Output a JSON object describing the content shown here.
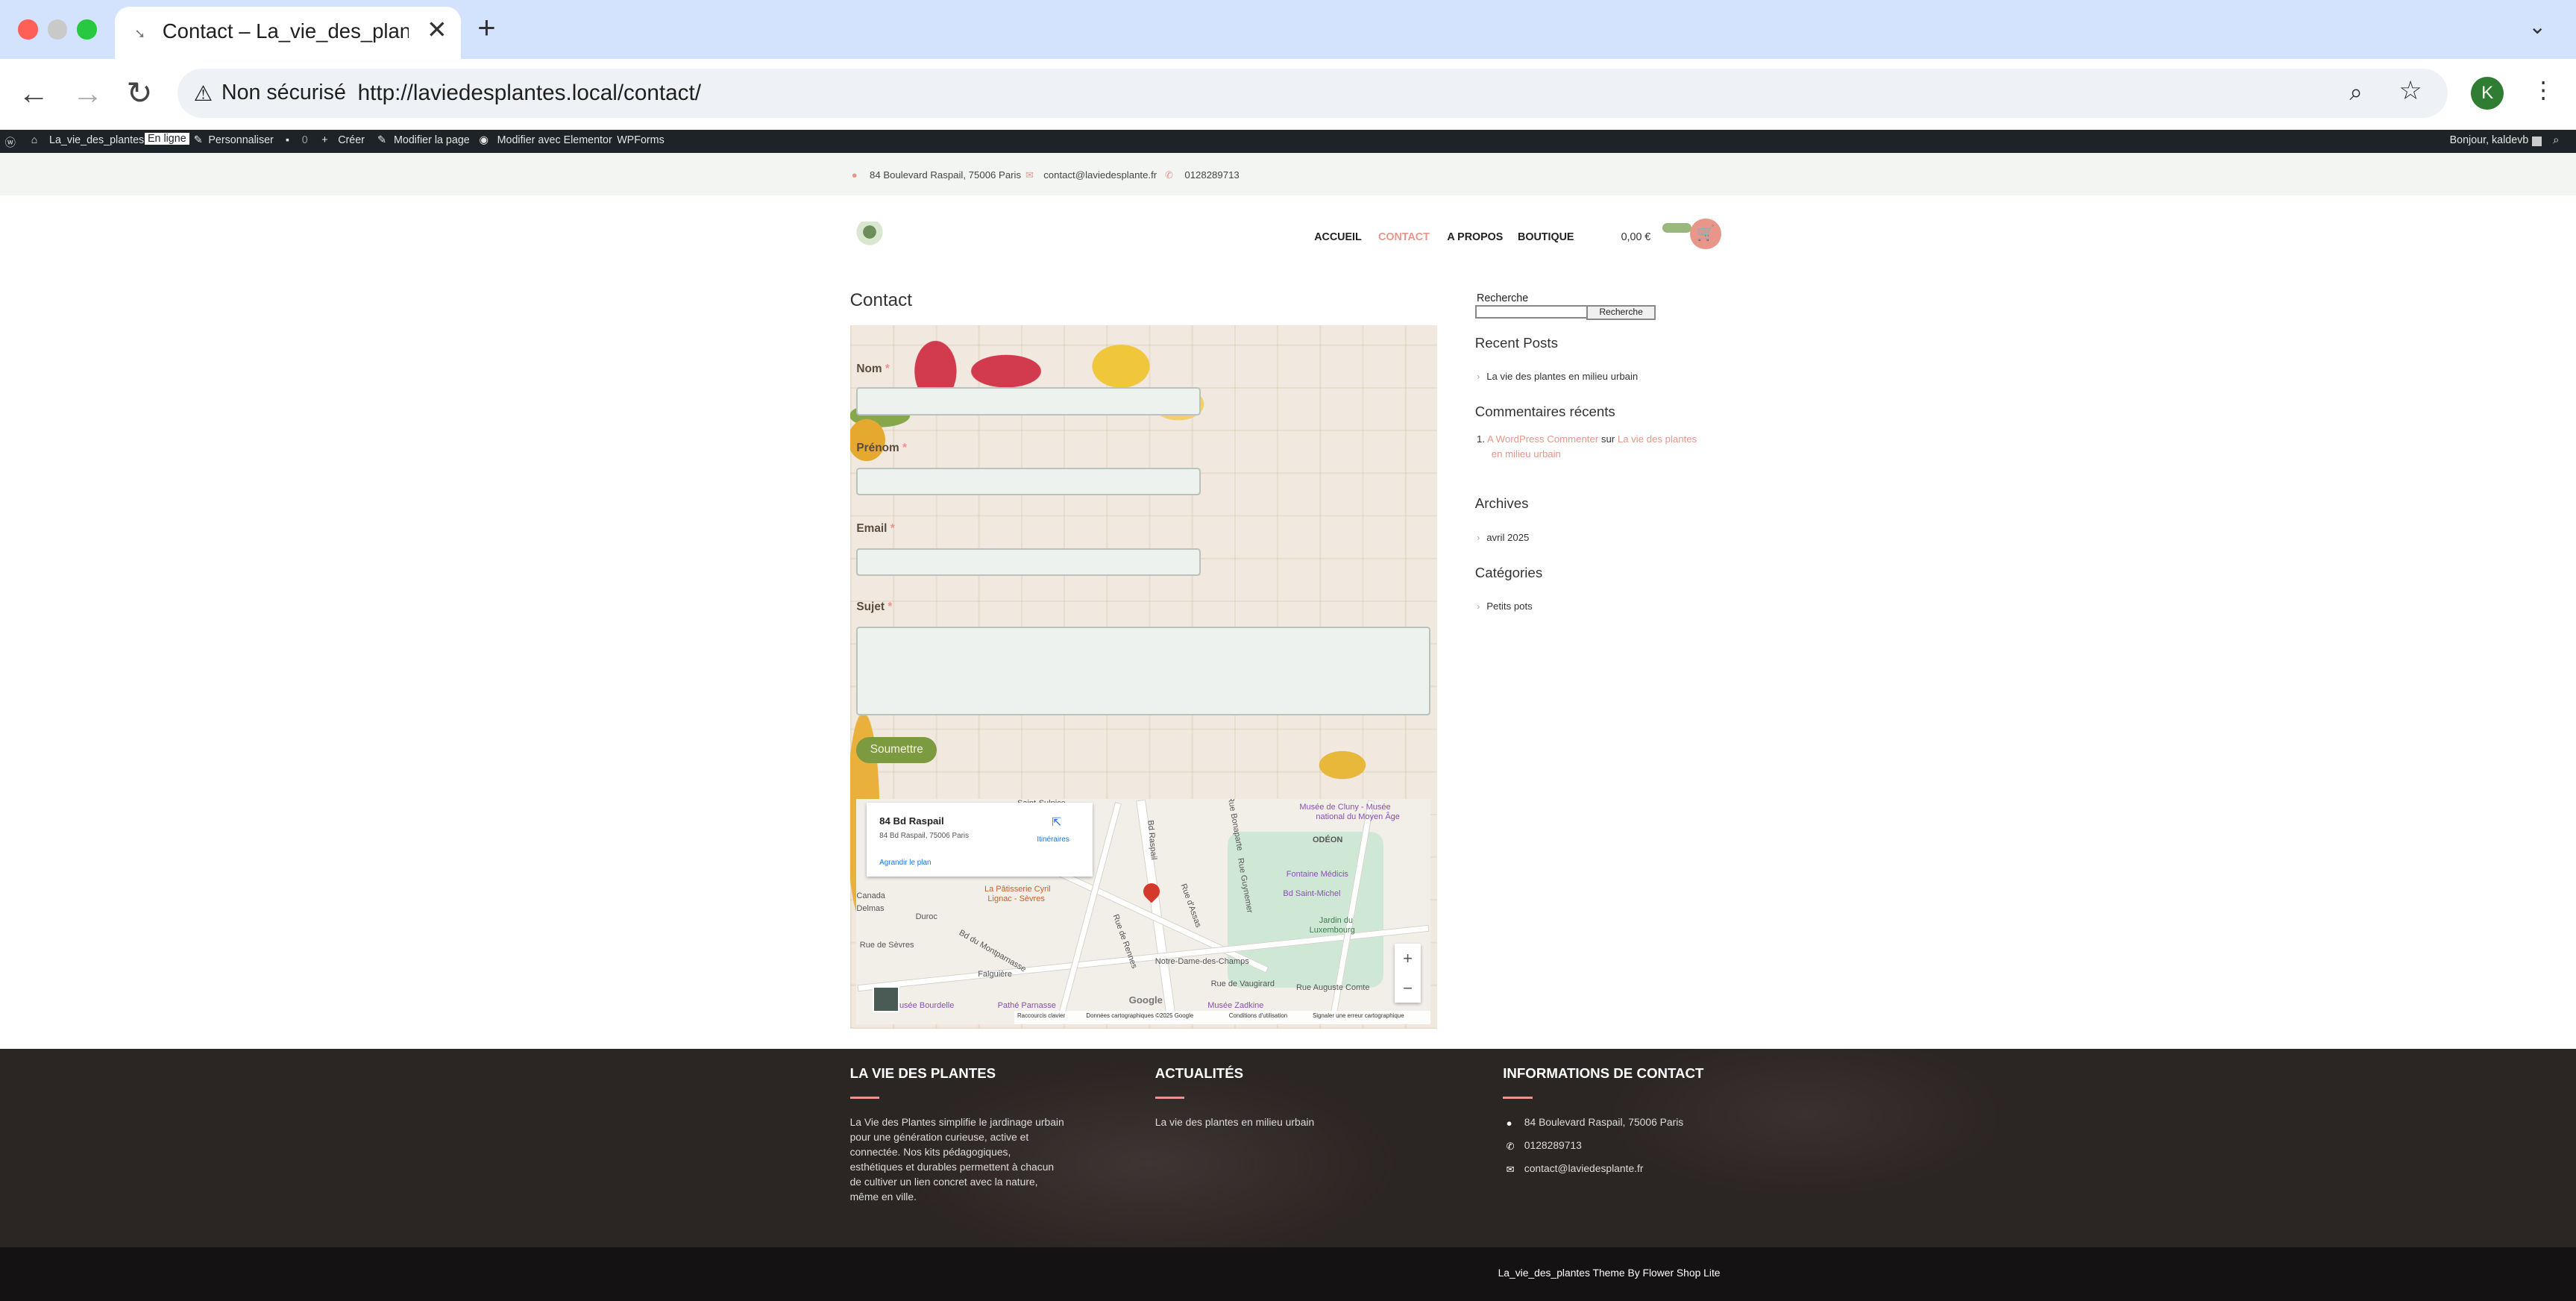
{
  "browser": {
    "tab_title": "Contact – La_vie_des_plantes",
    "new_tab": "+",
    "tab_close": "✕",
    "security": "Non sécurisé",
    "url": "http://laviedesplantes.local/contact/",
    "profile_initial": "K"
  },
  "admin_bar": {
    "site_name": "La_vie_des_plantes",
    "status": "En ligne",
    "customize": "Personnaliser",
    "comments_count": "0",
    "create": "Créer",
    "edit_page": "Modifier la page",
    "edit_elementor": "Modifier avec Elementor",
    "wpforms": "WPForms",
    "greeting": "Bonjour, kaldevb"
  },
  "info_bar": {
    "address": "84 Boulevard Raspail, 75006 Paris",
    "email": "contact@laviedesplante.fr",
    "phone": "0128289713"
  },
  "nav": {
    "items": [
      "ACCUEIL",
      "CONTACT",
      "A PROPOS",
      "BOUTIQUE"
    ],
    "active": "CONTACT",
    "cart_total": "0,00 €"
  },
  "page": {
    "title": "Contact"
  },
  "form": {
    "name_label": "Nom",
    "firstname_label": "Prénom",
    "email_label": "Email",
    "subject_label": "Sujet",
    "required_mark": "*",
    "submit_label": "Soumettre"
  },
  "map": {
    "card_title": "84 Bd Raspail",
    "card_address": "84 Bd Raspail, 75006 Paris",
    "directions": "Itinéraires",
    "enlarge": "Agrandir le plan",
    "labels": {
      "cluny": "Musée de Cluny - Musée",
      "cluny2": "national du Moyen Âge",
      "odeon": "ODÉON",
      "medicis": "Fontaine Médicis",
      "saint_michel": "Bd Saint-Michel",
      "jardin": "Jardin du",
      "luxembourg": "Luxembourg",
      "patisserie": "La Pâtisserie Cyril",
      "patisserie2": "Lignac - Sèvres",
      "notre_dame": "Notre-Dame-des-Champs",
      "bourdelle": "Musée Bourdelle",
      "pathe": "Pathé Parnasse",
      "zadkine": "Musée Zadkine",
      "falguiere": "Falguière",
      "duroc": "Duroc",
      "sevres": "Rue de Sèvres",
      "vaugirard": "Rue de Vaugirard",
      "raspail": "Bd Raspail",
      "rennes": "Rue de Rennes",
      "montparnasse": "Bd du Montparnasse",
      "assas": "Rue d'Assas",
      "auguste_comte": "Rue Auguste Comte",
      "guynemer": "Rue Guynemer",
      "bonaparte": "Rue Bonaparte",
      "st_sulpice": "Saint-Sulpice",
      "canada": "Canada",
      "delmas": "Delmas"
    },
    "zoom_in": "+",
    "zoom_out": "−",
    "google": "Google",
    "footer": {
      "shortcuts": "Raccourcis clavier",
      "data": "Données cartographiques ©2025 Google",
      "terms": "Conditions d'utilisation",
      "report": "Signaler une erreur cartographique"
    }
  },
  "sidebar": {
    "search_label": "Recherche",
    "search_button": "Recherche",
    "recent_posts_title": "Recent Posts",
    "recent_posts": [
      "La vie des plantes en milieu urbain"
    ],
    "comments_title": "Commentaires récents",
    "comment": {
      "number": "1.",
      "author": "A WordPress Commenter",
      "on": "sur",
      "post_line1": "La vie des plantes",
      "post_line2": "en milieu urbain"
    },
    "archives_title": "Archives",
    "archives": [
      "avril 2025"
    ],
    "categories_title": "Catégories",
    "categories": [
      "Petits pots"
    ]
  },
  "footer": {
    "col1_title": "LA VIE DES PLANTES",
    "col1_text": [
      "La Vie des Plantes simplifie le jardinage urbain",
      "pour une génération curieuse, active et",
      "connectée. Nos kits pédagogiques,",
      "esthétiques et durables permettent à chacun",
      "de cultiver un lien concret avec la nature,",
      "même en ville."
    ],
    "col2_title": "ACTUALITÉS",
    "col2_items": [
      "La vie des plantes en milieu urbain"
    ],
    "col3_title": "INFORMATIONS DE CONTACT",
    "address": "84 Boulevard Raspail, 75006 Paris",
    "phone": "0128289713",
    "email": "contact@laviedesplante.fr"
  },
  "credits": "La_vie_des_plantes Theme By Flower Shop Lite",
  "colors": {
    "accent": "#e8958a",
    "submit_green": "#7c9a3f",
    "admin_bar": "#1d2327",
    "footer_bg": "#2b2523",
    "tabstrip": "#d3e3fd"
  }
}
